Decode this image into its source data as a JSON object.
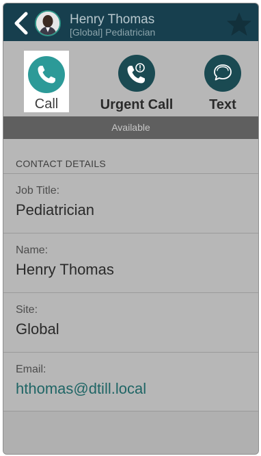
{
  "header": {
    "back_icon": "chevron-left-icon",
    "name": "Henry Thomas",
    "subtitle": "[Global] Pediatrician",
    "favorite_icon": "star-icon",
    "colors": {
      "bar": "#173f4e",
      "accent": "#2f9688"
    }
  },
  "actions": [
    {
      "label": "Call",
      "icon": "phone-icon"
    },
    {
      "label": "Urgent Call",
      "icon": "urgent-phone-icon"
    },
    {
      "label": "Text",
      "icon": "chat-bubbles-icon"
    }
  ],
  "status": "Available",
  "contact": {
    "section_title": "CONTACT DETAILS",
    "fields": [
      {
        "label": "Job Title:",
        "value": "Pediatrician"
      },
      {
        "label": "Name:",
        "value": "Henry Thomas"
      },
      {
        "label": "Site:",
        "value": "Global"
      },
      {
        "label": "Email:",
        "value": "hthomas@dtill.local"
      }
    ]
  }
}
